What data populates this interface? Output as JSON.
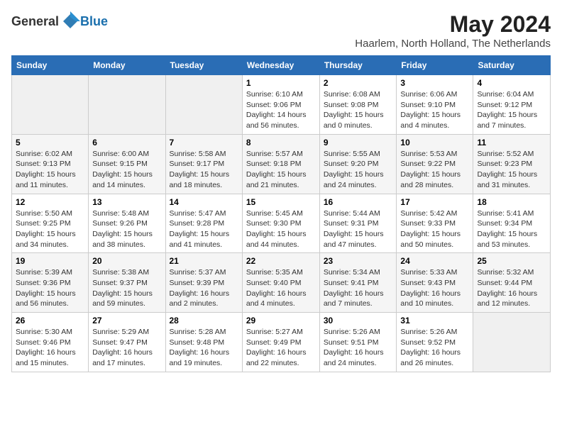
{
  "logo": {
    "general": "General",
    "blue": "Blue"
  },
  "header": {
    "month_year": "May 2024",
    "location": "Haarlem, North Holland, The Netherlands"
  },
  "days_of_week": [
    "Sunday",
    "Monday",
    "Tuesday",
    "Wednesday",
    "Thursday",
    "Friday",
    "Saturday"
  ],
  "weeks": [
    {
      "days": [
        {
          "num": "",
          "sunrise": "",
          "sunset": "",
          "daylight": "",
          "empty": true
        },
        {
          "num": "",
          "sunrise": "",
          "sunset": "",
          "daylight": "",
          "empty": true
        },
        {
          "num": "",
          "sunrise": "",
          "sunset": "",
          "daylight": "",
          "empty": true
        },
        {
          "num": "1",
          "sunrise": "Sunrise: 6:10 AM",
          "sunset": "Sunset: 9:06 PM",
          "daylight": "Daylight: 14 hours and 56 minutes.",
          "empty": false
        },
        {
          "num": "2",
          "sunrise": "Sunrise: 6:08 AM",
          "sunset": "Sunset: 9:08 PM",
          "daylight": "Daylight: 15 hours and 0 minutes.",
          "empty": false
        },
        {
          "num": "3",
          "sunrise": "Sunrise: 6:06 AM",
          "sunset": "Sunset: 9:10 PM",
          "daylight": "Daylight: 15 hours and 4 minutes.",
          "empty": false
        },
        {
          "num": "4",
          "sunrise": "Sunrise: 6:04 AM",
          "sunset": "Sunset: 9:12 PM",
          "daylight": "Daylight: 15 hours and 7 minutes.",
          "empty": false
        }
      ]
    },
    {
      "days": [
        {
          "num": "5",
          "sunrise": "Sunrise: 6:02 AM",
          "sunset": "Sunset: 9:13 PM",
          "daylight": "Daylight: 15 hours and 11 minutes.",
          "empty": false
        },
        {
          "num": "6",
          "sunrise": "Sunrise: 6:00 AM",
          "sunset": "Sunset: 9:15 PM",
          "daylight": "Daylight: 15 hours and 14 minutes.",
          "empty": false
        },
        {
          "num": "7",
          "sunrise": "Sunrise: 5:58 AM",
          "sunset": "Sunset: 9:17 PM",
          "daylight": "Daylight: 15 hours and 18 minutes.",
          "empty": false
        },
        {
          "num": "8",
          "sunrise": "Sunrise: 5:57 AM",
          "sunset": "Sunset: 9:18 PM",
          "daylight": "Daylight: 15 hours and 21 minutes.",
          "empty": false
        },
        {
          "num": "9",
          "sunrise": "Sunrise: 5:55 AM",
          "sunset": "Sunset: 9:20 PM",
          "daylight": "Daylight: 15 hours and 24 minutes.",
          "empty": false
        },
        {
          "num": "10",
          "sunrise": "Sunrise: 5:53 AM",
          "sunset": "Sunset: 9:22 PM",
          "daylight": "Daylight: 15 hours and 28 minutes.",
          "empty": false
        },
        {
          "num": "11",
          "sunrise": "Sunrise: 5:52 AM",
          "sunset": "Sunset: 9:23 PM",
          "daylight": "Daylight: 15 hours and 31 minutes.",
          "empty": false
        }
      ]
    },
    {
      "days": [
        {
          "num": "12",
          "sunrise": "Sunrise: 5:50 AM",
          "sunset": "Sunset: 9:25 PM",
          "daylight": "Daylight: 15 hours and 34 minutes.",
          "empty": false
        },
        {
          "num": "13",
          "sunrise": "Sunrise: 5:48 AM",
          "sunset": "Sunset: 9:26 PM",
          "daylight": "Daylight: 15 hours and 38 minutes.",
          "empty": false
        },
        {
          "num": "14",
          "sunrise": "Sunrise: 5:47 AM",
          "sunset": "Sunset: 9:28 PM",
          "daylight": "Daylight: 15 hours and 41 minutes.",
          "empty": false
        },
        {
          "num": "15",
          "sunrise": "Sunrise: 5:45 AM",
          "sunset": "Sunset: 9:30 PM",
          "daylight": "Daylight: 15 hours and 44 minutes.",
          "empty": false
        },
        {
          "num": "16",
          "sunrise": "Sunrise: 5:44 AM",
          "sunset": "Sunset: 9:31 PM",
          "daylight": "Daylight: 15 hours and 47 minutes.",
          "empty": false
        },
        {
          "num": "17",
          "sunrise": "Sunrise: 5:42 AM",
          "sunset": "Sunset: 9:33 PM",
          "daylight": "Daylight: 15 hours and 50 minutes.",
          "empty": false
        },
        {
          "num": "18",
          "sunrise": "Sunrise: 5:41 AM",
          "sunset": "Sunset: 9:34 PM",
          "daylight": "Daylight: 15 hours and 53 minutes.",
          "empty": false
        }
      ]
    },
    {
      "days": [
        {
          "num": "19",
          "sunrise": "Sunrise: 5:39 AM",
          "sunset": "Sunset: 9:36 PM",
          "daylight": "Daylight: 15 hours and 56 minutes.",
          "empty": false
        },
        {
          "num": "20",
          "sunrise": "Sunrise: 5:38 AM",
          "sunset": "Sunset: 9:37 PM",
          "daylight": "Daylight: 15 hours and 59 minutes.",
          "empty": false
        },
        {
          "num": "21",
          "sunrise": "Sunrise: 5:37 AM",
          "sunset": "Sunset: 9:39 PM",
          "daylight": "Daylight: 16 hours and 2 minutes.",
          "empty": false
        },
        {
          "num": "22",
          "sunrise": "Sunrise: 5:35 AM",
          "sunset": "Sunset: 9:40 PM",
          "daylight": "Daylight: 16 hours and 4 minutes.",
          "empty": false
        },
        {
          "num": "23",
          "sunrise": "Sunrise: 5:34 AM",
          "sunset": "Sunset: 9:41 PM",
          "daylight": "Daylight: 16 hours and 7 minutes.",
          "empty": false
        },
        {
          "num": "24",
          "sunrise": "Sunrise: 5:33 AM",
          "sunset": "Sunset: 9:43 PM",
          "daylight": "Daylight: 16 hours and 10 minutes.",
          "empty": false
        },
        {
          "num": "25",
          "sunrise": "Sunrise: 5:32 AM",
          "sunset": "Sunset: 9:44 PM",
          "daylight": "Daylight: 16 hours and 12 minutes.",
          "empty": false
        }
      ]
    },
    {
      "days": [
        {
          "num": "26",
          "sunrise": "Sunrise: 5:30 AM",
          "sunset": "Sunset: 9:46 PM",
          "daylight": "Daylight: 16 hours and 15 minutes.",
          "empty": false
        },
        {
          "num": "27",
          "sunrise": "Sunrise: 5:29 AM",
          "sunset": "Sunset: 9:47 PM",
          "daylight": "Daylight: 16 hours and 17 minutes.",
          "empty": false
        },
        {
          "num": "28",
          "sunrise": "Sunrise: 5:28 AM",
          "sunset": "Sunset: 9:48 PM",
          "daylight": "Daylight: 16 hours and 19 minutes.",
          "empty": false
        },
        {
          "num": "29",
          "sunrise": "Sunrise: 5:27 AM",
          "sunset": "Sunset: 9:49 PM",
          "daylight": "Daylight: 16 hours and 22 minutes.",
          "empty": false
        },
        {
          "num": "30",
          "sunrise": "Sunrise: 5:26 AM",
          "sunset": "Sunset: 9:51 PM",
          "daylight": "Daylight: 16 hours and 24 minutes.",
          "empty": false
        },
        {
          "num": "31",
          "sunrise": "Sunrise: 5:26 AM",
          "sunset": "Sunset: 9:52 PM",
          "daylight": "Daylight: 16 hours and 26 minutes.",
          "empty": false
        },
        {
          "num": "",
          "sunrise": "",
          "sunset": "",
          "daylight": "",
          "empty": true
        }
      ]
    }
  ]
}
